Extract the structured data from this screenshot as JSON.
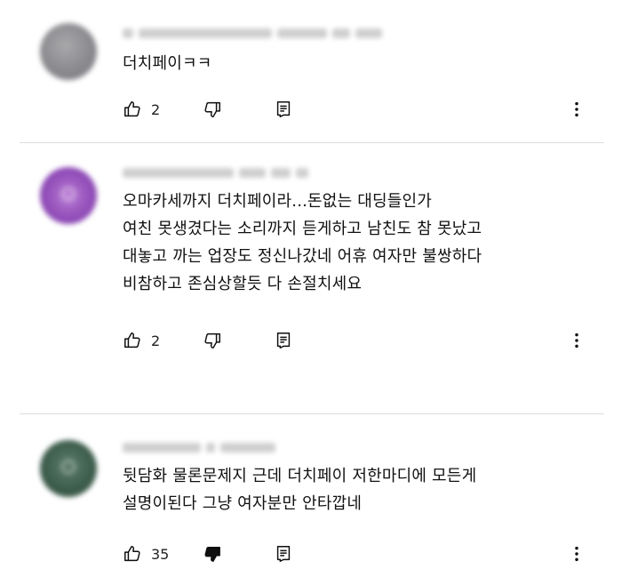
{
  "comments": [
    {
      "text": "더치페이ㅋㅋ",
      "likes": "2",
      "disliked": false,
      "avatar_color": "#8b8b8f"
    },
    {
      "text": "오마카세까지 더치페이라...돈없는 대딩들인가\n여친 못생겼다는 소리까지 듣게하고 남친도 참 못났고\n대놓고 까는 업장도 정신나갔네 어휴 여자만 불쌍하다\n비참하고 존심상할듯 다 손절치세요",
      "likes": "2",
      "disliked": false,
      "avatar_color": "#9b59c2"
    },
    {
      "text": "뒷담화 물론문제지 근데 더치페이 저한마디에 모든게\n설명이된다 그냥 여자분만 안타깝네",
      "likes": "35",
      "disliked": true,
      "avatar_color": "#3e5d4d"
    }
  ],
  "icons": {
    "like": "thumbs-up-icon",
    "dislike": "thumbs-down-icon",
    "reply": "reply-icon",
    "more": "more-vertical-icon"
  }
}
